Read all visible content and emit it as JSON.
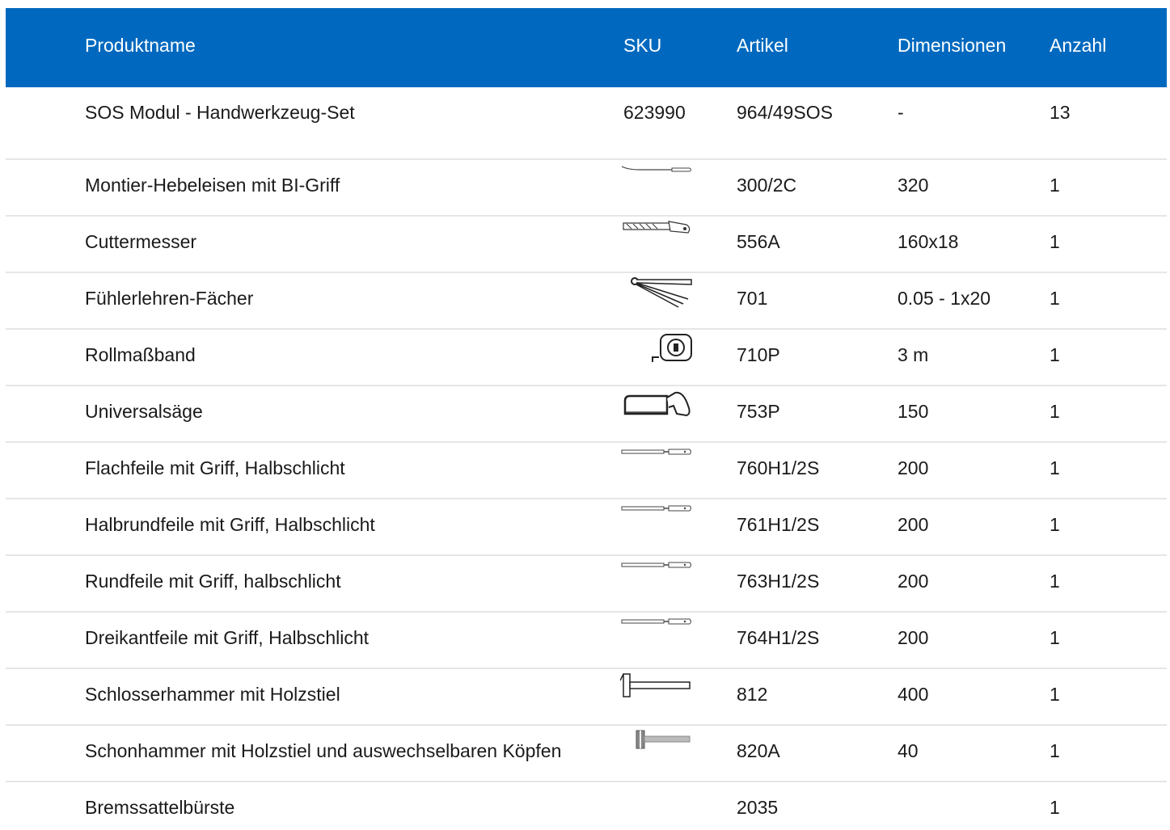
{
  "header": {
    "name": "Produktname",
    "sku": "SKU",
    "article": "Artikel",
    "dimensions": "Dimensionen",
    "quantity": "Anzahl"
  },
  "rows": [
    {
      "name": "SOS Modul - Handwerkzeug-Set",
      "sku": "623990",
      "article": "964/49SOS",
      "dimensions": "-",
      "quantity": "13",
      "icon": ""
    },
    {
      "name": "Montier-Hebeleisen mit BI-Griff",
      "sku": "",
      "article": "300/2C",
      "dimensions": "320",
      "quantity": "1",
      "icon": "pry-bar-icon"
    },
    {
      "name": "Cuttermesser",
      "sku": "",
      "article": "556A",
      "dimensions": "160x18",
      "quantity": "1",
      "icon": "cutter-knife-icon"
    },
    {
      "name": "Fühlerlehren-Fächer",
      "sku": "",
      "article": "701",
      "dimensions": "0.05 - 1x20",
      "quantity": "1",
      "icon": "feeler-gauge-icon"
    },
    {
      "name": "Rollmaßband",
      "sku": "",
      "article": "710P",
      "dimensions": "3 m",
      "quantity": "1",
      "icon": "tape-measure-icon"
    },
    {
      "name": "Universalsäge",
      "sku": "",
      "article": "753P",
      "dimensions": "150",
      "quantity": "1",
      "icon": "hacksaw-icon"
    },
    {
      "name": "Flachfeile mit Griff, Halbschlicht",
      "sku": "",
      "article": "760H1/2S",
      "dimensions": "200",
      "quantity": "1",
      "icon": "file-icon"
    },
    {
      "name": "Halbrundfeile mit Griff, Halbschlicht",
      "sku": "",
      "article": "761H1/2S",
      "dimensions": "200",
      "quantity": "1",
      "icon": "file-icon"
    },
    {
      "name": "Rundfeile mit Griff, halbschlicht",
      "sku": "",
      "article": "763H1/2S",
      "dimensions": "200",
      "quantity": "1",
      "icon": "file-icon"
    },
    {
      "name": "Dreikantfeile mit Griff, Halbschlicht",
      "sku": "",
      "article": "764H1/2S",
      "dimensions": "200",
      "quantity": "1",
      "icon": "file-icon"
    },
    {
      "name": "Schlosserhammer mit Holzstiel",
      "sku": "",
      "article": "812",
      "dimensions": "400",
      "quantity": "1",
      "icon": "hammer-icon"
    },
    {
      "name": "Schonhammer mit Holzstiel und auswechselbaren Köpfen",
      "sku": "",
      "article": "820A",
      "dimensions": "40",
      "quantity": "1",
      "icon": "soft-face-hammer-icon"
    },
    {
      "name": "Bremssattelbürste",
      "sku": "",
      "article": "2035",
      "dimensions": "",
      "quantity": "1",
      "icon": ""
    }
  ]
}
